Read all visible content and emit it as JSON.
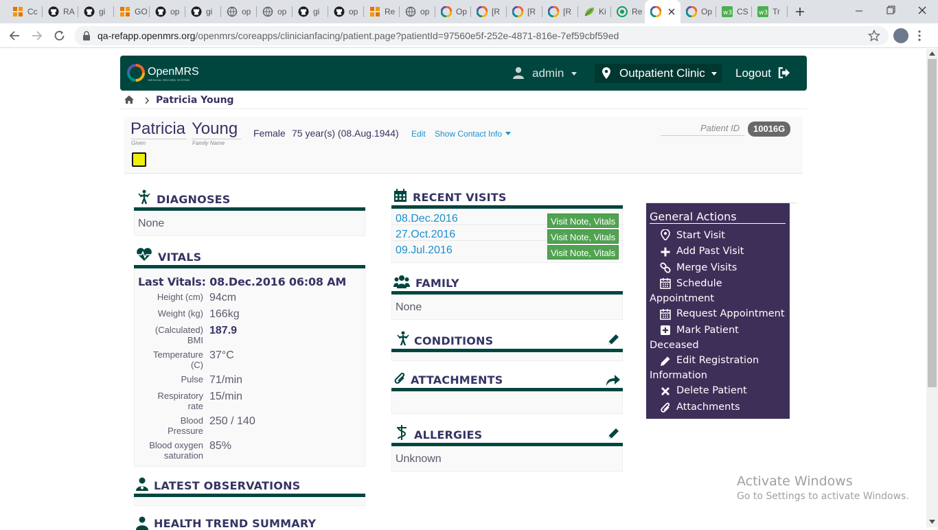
{
  "browser": {
    "tabs": [
      {
        "title": "Cc",
        "icon": "orange-grid-icon"
      },
      {
        "title": "RA",
        "icon": "github-icon"
      },
      {
        "title": "gi",
        "icon": "github-icon"
      },
      {
        "title": "GO",
        "icon": "orange-grid-icon"
      },
      {
        "title": "op",
        "icon": "github-icon"
      },
      {
        "title": "gi",
        "icon": "github-icon"
      },
      {
        "title": "op",
        "icon": "globe-icon"
      },
      {
        "title": "op",
        "icon": "globe-icon"
      },
      {
        "title": "gi",
        "icon": "github-icon"
      },
      {
        "title": "op",
        "icon": "github-icon"
      },
      {
        "title": "Re",
        "icon": "orange-grid-icon"
      },
      {
        "title": "op",
        "icon": "globe-icon"
      },
      {
        "title": "Op",
        "icon": "openmrs-icon"
      },
      {
        "title": "[R",
        "icon": "openmrs-icon"
      },
      {
        "title": "[R",
        "icon": "openmrs-icon"
      },
      {
        "title": "[R",
        "icon": "openmrs-icon"
      },
      {
        "title": "Ki",
        "icon": "leaf-icon"
      },
      {
        "title": "Re",
        "icon": "green-circle-icon"
      },
      {
        "title": "",
        "icon": "openmrs-icon"
      },
      {
        "title": "Op",
        "icon": "openmrs-icon"
      },
      {
        "title": "CS",
        "icon": "w3-icon"
      },
      {
        "title": "Tr",
        "icon": "w3-icon"
      }
    ],
    "url_host": "qa-refapp.openmrs.org",
    "url_path": "/openmrs/coreapps/clinicianfacing/patient.page?patientId=97560e5f-252e-4871-816e-7ef59cbf59ed"
  },
  "header": {
    "logo_text": "OpenMRS",
    "logo_sub": "MEDICAL RECORD SYSTEM",
    "user": "admin",
    "location": "Outpatient Clinic",
    "logout": "Logout"
  },
  "breadcrumb": {
    "patient": "Patricia Young"
  },
  "patient": {
    "given_name": "Patricia",
    "family_name": "Young",
    "given_label": "Given",
    "family_label": "Family Name",
    "gender": "Female",
    "age": "75 year(s) (08.Aug.1944)",
    "edit": "Edit",
    "show_contact": "Show Contact Info",
    "id_label": "Patient ID",
    "id": "10016G"
  },
  "diagnoses": {
    "title": "DIAGNOSES",
    "value": "None"
  },
  "vitals": {
    "title": "VITALS",
    "last": "Last Vitals: 08.Dec.2016 06:08 AM",
    "rows": [
      {
        "label": "Height (cm)",
        "value": "94cm"
      },
      {
        "label": "Weight (kg)",
        "value": "166kg"
      },
      {
        "label": "(Calculated) BMI",
        "value": "187.9"
      },
      {
        "label": "Temperature (C)",
        "value": "37°C"
      },
      {
        "label": "Pulse",
        "value": "71/min"
      },
      {
        "label": "Respiratory rate",
        "value": "15/min"
      },
      {
        "label": "Blood Pressure",
        "value": "250 / 140"
      },
      {
        "label": "Blood oxygen saturation",
        "value": "85%"
      }
    ]
  },
  "latest_obs": {
    "title": "LATEST OBSERVATIONS"
  },
  "health_trend": {
    "title": "HEALTH TREND SUMMARY"
  },
  "recent_visits": {
    "title": "RECENT VISITS",
    "items": [
      {
        "date": "08.Dec.2016",
        "tag": "Visit Note, Vitals"
      },
      {
        "date": "27.Oct.2016",
        "tag": "Visit Note, Vitals"
      },
      {
        "date": "09.Jul.2016",
        "tag": "Visit Note, Vitals"
      }
    ]
  },
  "family": {
    "title": "FAMILY",
    "value": "None"
  },
  "conditions": {
    "title": "CONDITIONS"
  },
  "attachments": {
    "title": "ATTACHMENTS"
  },
  "allergies": {
    "title": "ALLERGIES",
    "value": "Unknown"
  },
  "general_actions": {
    "title": "General Actions",
    "items": [
      {
        "label": "Start Visit",
        "icon": "map-marker-icon"
      },
      {
        "label": "Add Past Visit",
        "icon": "plus-icon"
      },
      {
        "label": "Merge Visits",
        "icon": "link-icon"
      },
      {
        "label": "Schedule",
        "label2": "Appointment",
        "icon": "calendar-icon"
      },
      {
        "label": "Request Appointment",
        "icon": "calendar-icon"
      },
      {
        "label": "Mark Patient",
        "label2": "Deceased",
        "icon": "plus-square-icon"
      },
      {
        "label": "Edit Registration",
        "label2": "Information",
        "icon": "pencil-icon"
      },
      {
        "label": "Delete Patient",
        "icon": "x-icon"
      },
      {
        "label": "Attachments",
        "icon": "paperclip-icon"
      }
    ]
  },
  "watermark": {
    "line1": "Activate Windows",
    "line2": "Go to Settings to activate Windows."
  },
  "colors": {
    "header": "#00463f",
    "actions_bg": "#3e2f59",
    "visit_tag": "#51a351",
    "link": "#1a8fcf"
  }
}
